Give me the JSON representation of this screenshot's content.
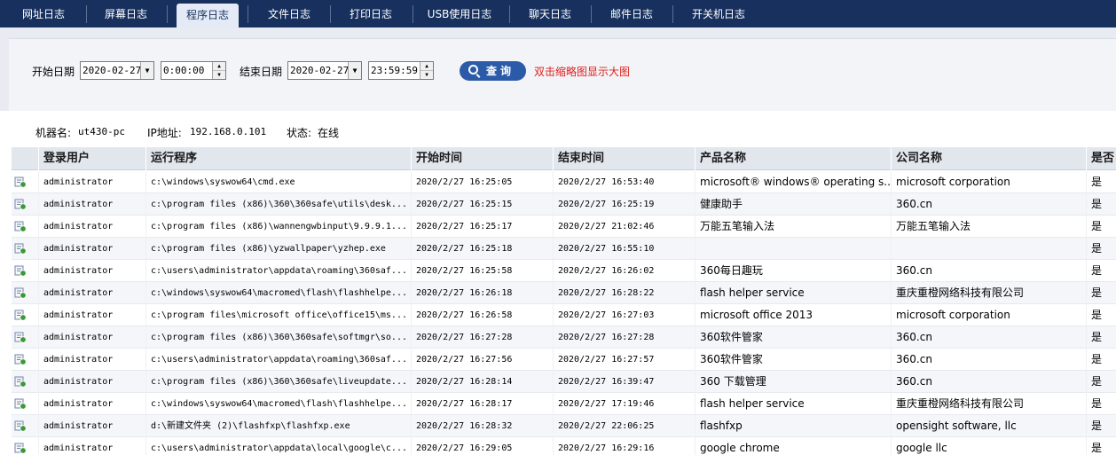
{
  "tabs": [
    {
      "label": "网址日志",
      "active": false
    },
    {
      "label": "屏幕日志",
      "active": false
    },
    {
      "label": "程序日志",
      "active": true
    },
    {
      "label": "文件日志",
      "active": false
    },
    {
      "label": "打印日志",
      "active": false
    },
    {
      "label": "USB使用日志",
      "active": false
    },
    {
      "label": "聊天日志",
      "active": false
    },
    {
      "label": "邮件日志",
      "active": false
    },
    {
      "label": "开关机日志",
      "active": false
    }
  ],
  "query": {
    "start_label": "开始日期",
    "start_date": "2020-02-27",
    "start_time": "0:00:00",
    "end_label": "结束日期",
    "end_date": "2020-02-27",
    "end_time": "23:59:59",
    "query_button": "查询",
    "hint": "双击缩略图显示大图"
  },
  "machine": {
    "name_label": "机器名:",
    "name": "ut430-pc",
    "ip_label": "IP地址:",
    "ip": "192.168.0.101",
    "status_label": "状态:",
    "status": "在线"
  },
  "table": {
    "columns": [
      "登录用户",
      "运行程序",
      "开始时间",
      "结束时间",
      "产品名称",
      "公司名称",
      "是否"
    ],
    "rows": [
      [
        "administrator",
        "c:\\windows\\syswow64\\cmd.exe",
        "2020/2/27 16:25:05",
        "2020/2/27 16:53:40",
        "microsoft® windows® operating s...",
        "microsoft corporation",
        "是"
      ],
      [
        "administrator",
        "c:\\program files (x86)\\360\\360safe\\utils\\desk...",
        "2020/2/27 16:25:15",
        "2020/2/27 16:25:19",
        "健康助手",
        "360.cn",
        "是"
      ],
      [
        "administrator",
        "c:\\program files (x86)\\wannengwbinput\\9.9.9.1...",
        "2020/2/27 16:25:17",
        "2020/2/27 21:02:46",
        "万能五笔输入法",
        "万能五笔输入法",
        "是"
      ],
      [
        "administrator",
        "c:\\program files (x86)\\yzwallpaper\\yzhep.exe",
        "2020/2/27 16:25:18",
        "2020/2/27 16:55:10",
        "",
        "",
        "是"
      ],
      [
        "administrator",
        "c:\\users\\administrator\\appdata\\roaming\\360saf...",
        "2020/2/27 16:25:58",
        "2020/2/27 16:26:02",
        "360每日趣玩",
        "360.cn",
        "是"
      ],
      [
        "administrator",
        "c:\\windows\\syswow64\\macromed\\flash\\flashhelpe...",
        "2020/2/27 16:26:18",
        "2020/2/27 16:28:22",
        "flash helper service",
        "重庆重橙网络科技有限公司",
        "是"
      ],
      [
        "administrator",
        "c:\\program files\\microsoft office\\office15\\ms...",
        "2020/2/27 16:26:58",
        "2020/2/27 16:27:03",
        "microsoft office 2013",
        "microsoft corporation",
        "是"
      ],
      [
        "administrator",
        "c:\\program files (x86)\\360\\360safe\\softmgr\\so...",
        "2020/2/27 16:27:28",
        "2020/2/27 16:27:28",
        "360软件管家",
        "360.cn",
        "是"
      ],
      [
        "administrator",
        "c:\\users\\administrator\\appdata\\roaming\\360saf...",
        "2020/2/27 16:27:56",
        "2020/2/27 16:27:57",
        "360软件管家",
        "360.cn",
        "是"
      ],
      [
        "administrator",
        "c:\\program files (x86)\\360\\360safe\\liveupdate...",
        "2020/2/27 16:28:14",
        "2020/2/27 16:39:47",
        "360 下载管理",
        "360.cn",
        "是"
      ],
      [
        "administrator",
        "c:\\windows\\syswow64\\macromed\\flash\\flashhelpe...",
        "2020/2/27 16:28:17",
        "2020/2/27 17:19:46",
        "flash helper service",
        "重庆重橙网络科技有限公司",
        "是"
      ],
      [
        "administrator",
        "d:\\新建文件夹 (2)\\flashfxp\\flashfxp.exe",
        "2020/2/27 16:28:32",
        "2020/2/27 22:06:25",
        "flashfxp",
        "opensight software, llc",
        "是"
      ],
      [
        "administrator",
        "c:\\users\\administrator\\appdata\\local\\google\\c...",
        "2020/2/27 16:29:05",
        "2020/2/27 16:29:16",
        "google chrome",
        "google llc",
        "是"
      ]
    ]
  },
  "icons": {
    "row_icon": "program-log-icon",
    "query_icon": "search-icon",
    "dropdown_icon": "chevron-down-icon"
  },
  "colors": {
    "tab_bar": "#17305e",
    "query_button": "#2b5ba8",
    "hint_text": "#e0201c"
  }
}
